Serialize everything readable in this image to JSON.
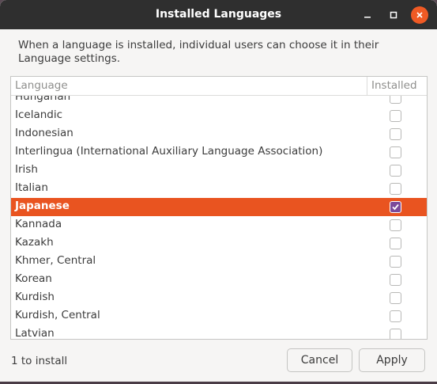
{
  "window": {
    "title": "Installed Languages"
  },
  "description": "When a language is installed, individual users can choose it in their Language settings.",
  "list": {
    "columns": {
      "language": "Language",
      "installed": "Installed"
    },
    "rows": [
      {
        "label": "Hungarian",
        "installed": false,
        "selected": false
      },
      {
        "label": "Icelandic",
        "installed": false,
        "selected": false
      },
      {
        "label": "Indonesian",
        "installed": false,
        "selected": false
      },
      {
        "label": "Interlingua (International Auxiliary Language Association)",
        "installed": false,
        "selected": false
      },
      {
        "label": "Irish",
        "installed": false,
        "selected": false
      },
      {
        "label": "Italian",
        "installed": false,
        "selected": false
      },
      {
        "label": "Japanese",
        "installed": true,
        "selected": true
      },
      {
        "label": "Kannada",
        "installed": false,
        "selected": false
      },
      {
        "label": "Kazakh",
        "installed": false,
        "selected": false
      },
      {
        "label": "Khmer, Central",
        "installed": false,
        "selected": false
      },
      {
        "label": "Korean",
        "installed": false,
        "selected": false
      },
      {
        "label": "Kurdish",
        "installed": false,
        "selected": false
      },
      {
        "label": "Kurdish, Central",
        "installed": false,
        "selected": false
      },
      {
        "label": "Latvian",
        "installed": false,
        "selected": false
      }
    ]
  },
  "footer": {
    "status": "1 to install",
    "cancel_label": "Cancel",
    "apply_label": "Apply"
  },
  "colors": {
    "accent": "#e95420",
    "checked": "#7b4a9a",
    "titlebar": "#2f2f2f"
  },
  "icons": {
    "minimize": "minimize-icon",
    "maximize": "maximize-icon",
    "close": "close-icon",
    "check": "checkmark-icon"
  }
}
